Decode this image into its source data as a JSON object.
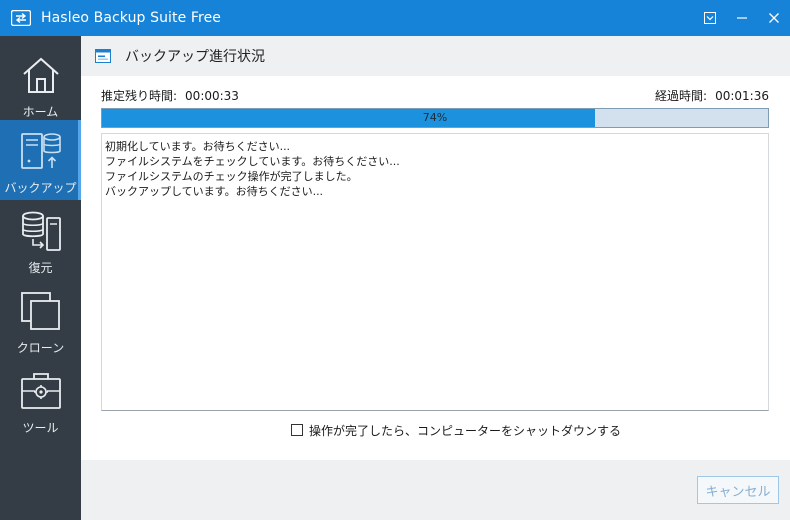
{
  "window": {
    "title": "Hasleo Backup Suite Free"
  },
  "sidebar": {
    "items": [
      {
        "label": "ホーム",
        "icon": "home-icon",
        "active": false
      },
      {
        "label": "バックアップ",
        "icon": "backup-icon",
        "active": true
      },
      {
        "label": "復元",
        "icon": "restore-icon",
        "active": false
      },
      {
        "label": "クローン",
        "icon": "clone-icon",
        "active": false
      },
      {
        "label": "ツール",
        "icon": "toolbox-icon",
        "active": false
      }
    ]
  },
  "main": {
    "title": "バックアップ進行状況",
    "remaining": {
      "label": "推定残り時間:",
      "value": "00:00:33"
    },
    "elapsed": {
      "label": "経過時間:",
      "value": "00:01:36"
    },
    "progress": {
      "percent": 74,
      "text": "74%"
    },
    "log": [
      "初期化しています。お待ちください...",
      "ファイルシステムをチェックしています。お待ちください...",
      "ファイルシステムのチェック操作が完了しました。",
      "バックアップしています。お待ちください..."
    ],
    "shutdown_label": "操作が完了したら、コンピューターをシャットダウンする",
    "shutdown_checked": false,
    "cancel_label": "キャンセル"
  },
  "colors": {
    "titlebar": "#1683d8",
    "sidebar": "#343d45",
    "sidebar_active": "#1e6fb4",
    "progress_fill": "#1c92de",
    "progress_track": "#d3e1ee"
  }
}
